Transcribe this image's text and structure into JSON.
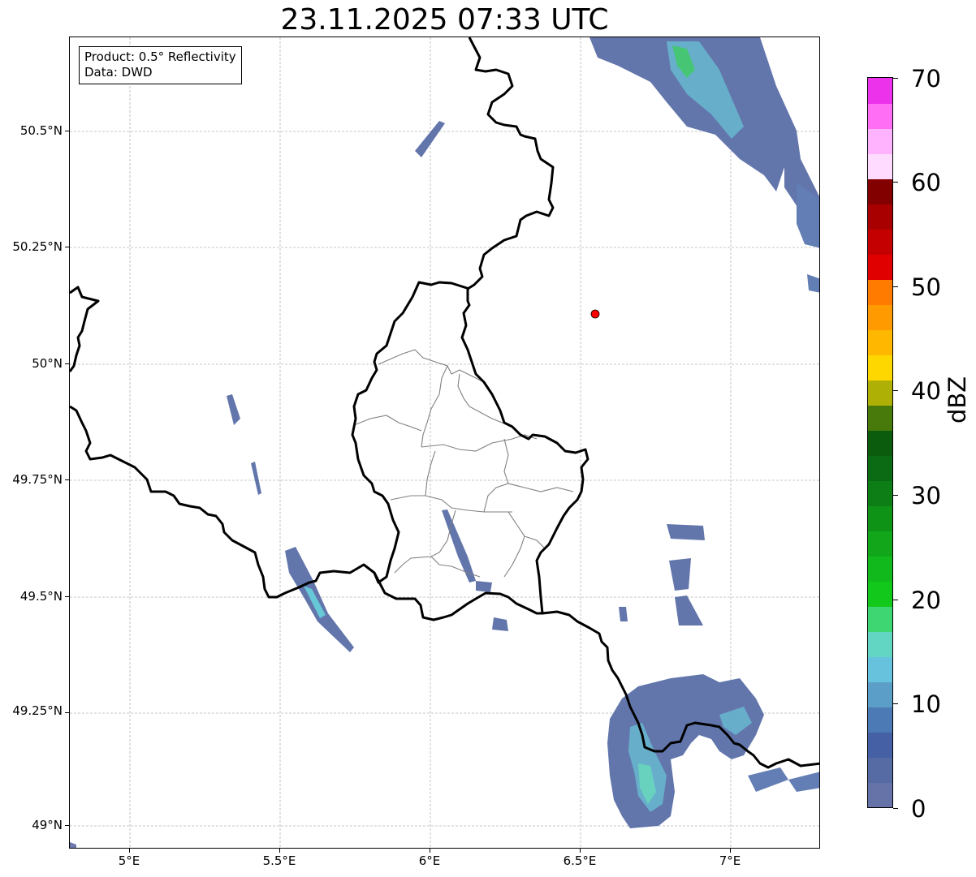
{
  "title": "23.11.2025 07:33 UTC",
  "info": {
    "product": "Product: 0.5° Reflectivity",
    "data": "Data: DWD"
  },
  "axes": {
    "x_ticks": [
      "5°E",
      "5.5°E",
      "6°E",
      "6.5°E",
      "7°E"
    ],
    "y_ticks": [
      "50.5°N",
      "50.25°N",
      "50°N",
      "49.75°N",
      "49.5°N",
      "49.25°N",
      "49°N"
    ],
    "lon_range": [
      4.8,
      7.3
    ],
    "lat_range": [
      48.95,
      50.7
    ]
  },
  "marker": {
    "name": "radar-site",
    "lon": 6.55,
    "lat": 50.11,
    "color": "#ff0000"
  },
  "colorbar": {
    "label": "dBZ",
    "ticks": [
      "0",
      "10",
      "20",
      "30",
      "40",
      "50",
      "60",
      "70"
    ],
    "range": [
      0,
      70
    ],
    "colors": [
      "#6673a8",
      "#566aa3",
      "#4660a5",
      "#4b7ab4",
      "#5b9fc9",
      "#66c2dd",
      "#62d6c3",
      "#3dd673",
      "#12c91b",
      "#11b91d",
      "#12a71b",
      "#0f9317",
      "#0c7e15",
      "#0b6a14",
      "#0b5c0c",
      "#477a0b",
      "#afb006",
      "#ffd700",
      "#ffb700",
      "#ff9a00",
      "#ff7b00",
      "#e00000",
      "#c40000",
      "#a80000",
      "#820000",
      "#ffdcff",
      "#ffb3ff",
      "#ff6ef5",
      "#ec32eb"
    ]
  }
}
